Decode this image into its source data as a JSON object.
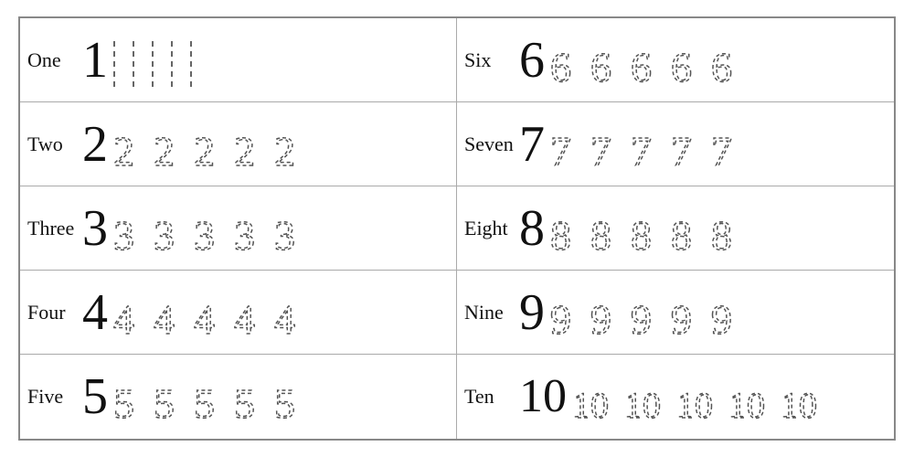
{
  "rows": [
    {
      "id": "one",
      "label": "One",
      "digit": "1",
      "traceCount": 5,
      "col": "left"
    },
    {
      "id": "six",
      "label": "Six",
      "digit": "6",
      "traceCount": 5,
      "col": "right"
    },
    {
      "id": "two",
      "label": "Two",
      "digit": "2",
      "traceCount": 5,
      "col": "left"
    },
    {
      "id": "seven",
      "label": "Seven",
      "digit": "7",
      "traceCount": 5,
      "col": "right"
    },
    {
      "id": "three",
      "label": "Three",
      "digit": "3",
      "traceCount": 5,
      "col": "left"
    },
    {
      "id": "eight",
      "label": "Eight",
      "digit": "8",
      "traceCount": 5,
      "col": "right"
    },
    {
      "id": "four",
      "label": "Four",
      "digit": "4",
      "traceCount": 5,
      "col": "left"
    },
    {
      "id": "nine",
      "label": "Nine",
      "digit": "9",
      "traceCount": 5,
      "col": "right"
    },
    {
      "id": "five",
      "label": "Five",
      "digit": "5",
      "traceCount": 5,
      "col": "left"
    },
    {
      "id": "ten",
      "label": "Ten",
      "digit": "10",
      "traceCount": 5,
      "col": "right"
    }
  ]
}
